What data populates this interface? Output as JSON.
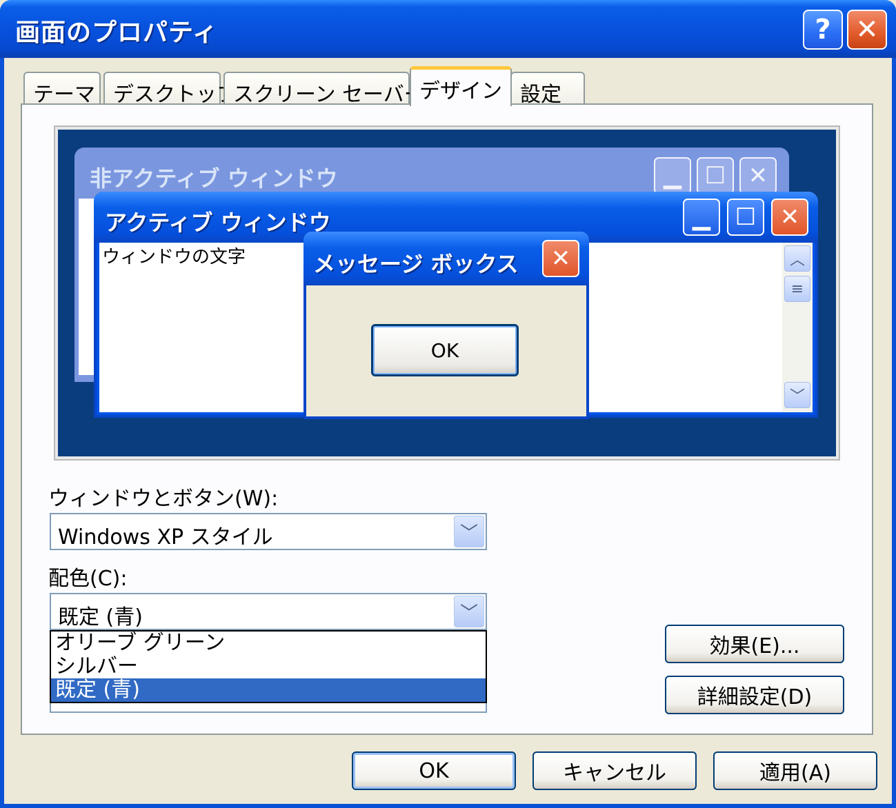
{
  "window": {
    "title": "画面のプロパティ",
    "help_label": "?",
    "close_label": "✕"
  },
  "tabs": [
    {
      "label": "テーマ"
    },
    {
      "label": "デスクトップ"
    },
    {
      "label": "スクリーン セーバー"
    },
    {
      "label": "デザイン",
      "active": true
    },
    {
      "label": "設定"
    }
  ],
  "preview": {
    "inactive_title": "非アクティブ ウィンドウ",
    "active_title": "アクティブ ウィンドウ",
    "window_text": "ウィンドウの文字",
    "message_title": "メッセージ ボックス",
    "message_ok": "OK",
    "min_glyph": "▁",
    "max_glyph": "☐",
    "close_glyph": "✕",
    "scroll_up": "︿",
    "scroll_thumb": "≡",
    "scroll_down": "﹀"
  },
  "form": {
    "windows_buttons_label": "ウィンドウとボタン(W):",
    "windows_buttons_value": "Windows XP スタイル",
    "color_scheme_label": "配色(C):",
    "color_scheme_value": "既定 (青)",
    "color_scheme_options": [
      "オリーブ グリーン",
      "シルバー",
      "既定 (青)"
    ],
    "arrow_glyph": "﹀"
  },
  "buttons": {
    "effects": "効果(E)...",
    "advanced": "詳細設定(D)",
    "ok": "OK",
    "cancel": "キャンセル",
    "apply": "適用(A)"
  },
  "colors": {
    "titlebar": "#0550dc",
    "desktop": "#0a3d7e",
    "selection": "#316ac5",
    "face": "#ece9d8"
  }
}
